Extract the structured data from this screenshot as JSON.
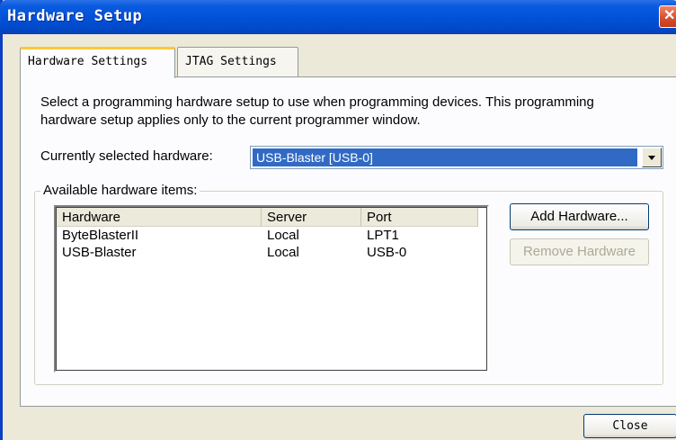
{
  "window": {
    "title": "Hardware Setup",
    "close_glyph": "✕"
  },
  "tabs": [
    {
      "label": "Hardware Settings",
      "active": true
    },
    {
      "label": "JTAG Settings",
      "active": false
    }
  ],
  "description": "Select a programming hardware setup to use when programming devices. This programming hardware setup applies only to the current programmer window.",
  "selected_hardware": {
    "label": "Currently selected hardware:",
    "value": "USB-Blaster [USB-0]"
  },
  "available": {
    "group_label": "Available hardware items:",
    "columns": [
      "Hardware",
      "Server",
      "Port"
    ],
    "rows": [
      {
        "hardware": "ByteBlasterII",
        "server": "Local",
        "port": "LPT1"
      },
      {
        "hardware": "USB-Blaster",
        "server": "Local",
        "port": "USB-0"
      }
    ],
    "add_button": "Add Hardware...",
    "remove_button": "Remove Hardware"
  },
  "footer": {
    "close_button": "Close"
  },
  "colors": {
    "titlebar": "#0151d8",
    "selection": "#316ac5",
    "tab_highlight": "#ffc83c"
  }
}
